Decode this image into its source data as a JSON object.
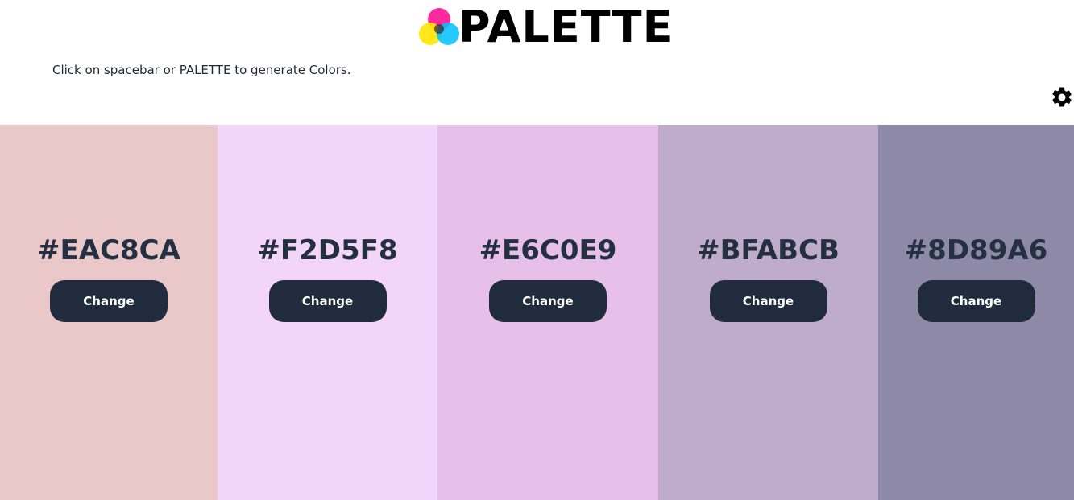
{
  "header": {
    "logo_text": "PALETTE",
    "hint": "Click on spacebar or PALETTE to generate Colors."
  },
  "icons": {
    "logo": "overlapping-color-circles-icon",
    "settings": "gear-icon"
  },
  "swatches": [
    {
      "hex": "#EAC8CA",
      "color": "#EAC8CA",
      "button_label": "Change"
    },
    {
      "hex": "#F2D5F8",
      "color": "#F2D5F8",
      "button_label": "Change"
    },
    {
      "hex": "#E6C0E9",
      "color": "#E6C0E9",
      "button_label": "Change"
    },
    {
      "hex": "#BFABCB",
      "color": "#BFABCB",
      "button_label": "Change"
    },
    {
      "hex": "#8D89A6",
      "color": "#8D89A6",
      "button_label": "Change"
    }
  ],
  "colors": {
    "button_bg": "#202C3D",
    "hex_text": "#243041"
  }
}
